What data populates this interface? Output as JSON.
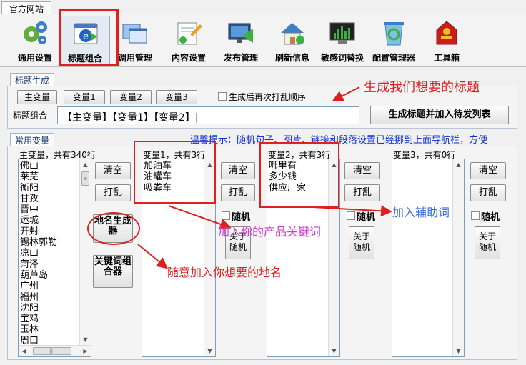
{
  "window": {
    "tab": "官方网站"
  },
  "toolbar": {
    "items": [
      {
        "label": "通用设置",
        "icon": "gears-icon"
      },
      {
        "label": "标题组合",
        "icon": "title-combine-icon"
      },
      {
        "label": "调用管理",
        "icon": "windows-manage-icon"
      },
      {
        "label": "内容设置",
        "icon": "content-settings-icon"
      },
      {
        "label": "发布管理",
        "icon": "publish-icon"
      },
      {
        "label": "刷新信息",
        "icon": "refresh-house-icon"
      },
      {
        "label": "敏感词替换",
        "icon": "sensitive-monitor-icon"
      },
      {
        "label": "配置管理器",
        "icon": "recycle-config-icon"
      },
      {
        "label": "工具箱",
        "icon": "toolbox-icon"
      }
    ]
  },
  "title_gen": {
    "group_label": "标题生成",
    "var_buttons": [
      "主变量",
      "变量1",
      "变量2",
      "变量3"
    ],
    "shuffle_label": "生成后再次打乱顺序",
    "combo_label": "标题组合",
    "combo_value": "【主变量】【变量1】【变量2】|",
    "generate_button": "生成标题并加入待发列表"
  },
  "vars": {
    "group_label": "常用变量",
    "hint": "温馨提示：随机句子、图片、链接和段落设置已经挪到上面导航栏，方便",
    "main": {
      "title": "主变量，共有340行",
      "items": [
        "佛山",
        "莱芜",
        "衡阳",
        "甘孜",
        "晋中",
        "运城",
        "开封",
        "锡林郭勒",
        "凉山",
        "菏泽",
        "葫芦岛",
        "广州",
        "福州",
        "沈阳",
        "宝鸡",
        "玉林",
        "周口"
      ],
      "clear": "清空",
      "shuffle": "打乱",
      "place_gen": "地名生成器",
      "keyword_gen": "关键词组合器"
    },
    "var1": {
      "title": "变量1，共有3行",
      "items": [
        "加油车",
        "油罐车",
        "吸粪车"
      ],
      "clear": "清空",
      "shuffle": "打乱",
      "random": "随机",
      "about": "关于随机"
    },
    "var2": {
      "title": "变量2，共有3行",
      "items": [
        "哪里有",
        "多少钱",
        "供应厂家"
      ],
      "clear": "清空",
      "shuffle": "打乱",
      "random": "随机",
      "about": "关于随机"
    },
    "var3": {
      "title": "变量3，共有0行",
      "items": [],
      "clear": "清空",
      "shuffle": "打乱",
      "random": "随机",
      "about": "关于随机"
    }
  },
  "annotations": {
    "title_note": "生成我们想要的标题",
    "keyword_note": "加入你的产品关键词",
    "aux_note": "加入辅助词",
    "place_note": "随意加入你想要的地名"
  },
  "colors": {
    "annotation": "#e02020",
    "hint": "#1030d0",
    "keyword_note": "#d040d0",
    "aux_note": "#4070e0"
  }
}
